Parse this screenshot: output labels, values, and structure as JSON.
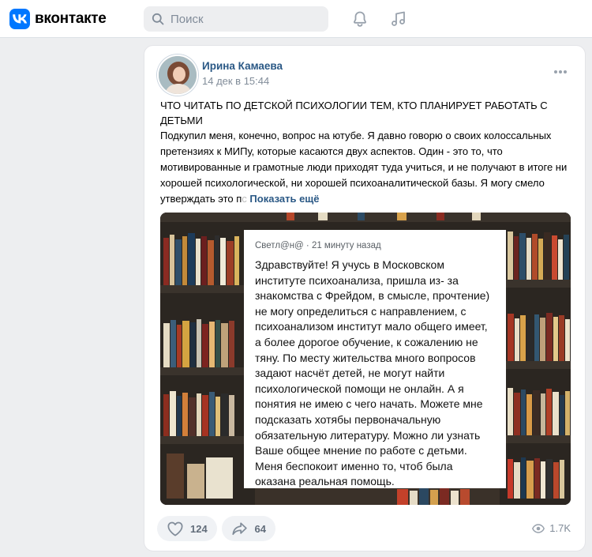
{
  "header": {
    "logo_text": "вконтакте",
    "search_placeholder": "Поиск"
  },
  "post": {
    "author": "Ирина Камаева",
    "time": "14 дек в 15:44",
    "title": "ЧТО ЧИТАТЬ ПО ДЕТСКОЙ ПСИХОЛОГИИ ТЕМ, КТО ПЛАНИРУЕТ РАБОТАТЬ С ДЕТЬМИ",
    "body": "Подкупил меня, конечно, вопрос на ютубе. Я давно говорю о своих колоссальных претензиях к МИПу, которые касаются двух аспектов. Один - это то, что мотивированные и грамотные люди приходят туда учиться, и не получают в итоге ни хорошей психологической, ни хорошей психоаналитической базы. Я могу смело утверждать это п",
    "body_fade": "с",
    "show_more": "Показать ещё",
    "quote": {
      "meta": "Светл@н@ · 21 минуту назад",
      "text": "Здравствуйте! Я учусь в Московском институте психоанализа, пришла из- за знакомства с Фрейдом, в смысле, прочтение) не могу определиться с направлением, с психоанализом институт мало общего имеет, а более дорогое обучение, к сожалению не тяну. По месту жительства много вопросов задают насчёт детей, не могут найти психологической помощи не онлайн. А я понятия не имею с чего начать. Можете мне подсказать хотябы первоначальную обязательную литературу. Можно ли узнать Ваше  общее мнение по работе с детьми. Меня беспокоит именно то, чтоб была оказана реальная помощь."
    },
    "likes": "124",
    "shares": "64",
    "views": "1.7K"
  },
  "colors": {
    "accent": "#0077ff",
    "link": "#2a5885",
    "muted": "#818c99",
    "page_bg": "#edeef0"
  },
  "icons": [
    "vk-logo-icon",
    "search-icon",
    "bell-icon",
    "music-note-icon",
    "more-dots-icon",
    "heart-icon",
    "share-icon",
    "eye-icon"
  ]
}
